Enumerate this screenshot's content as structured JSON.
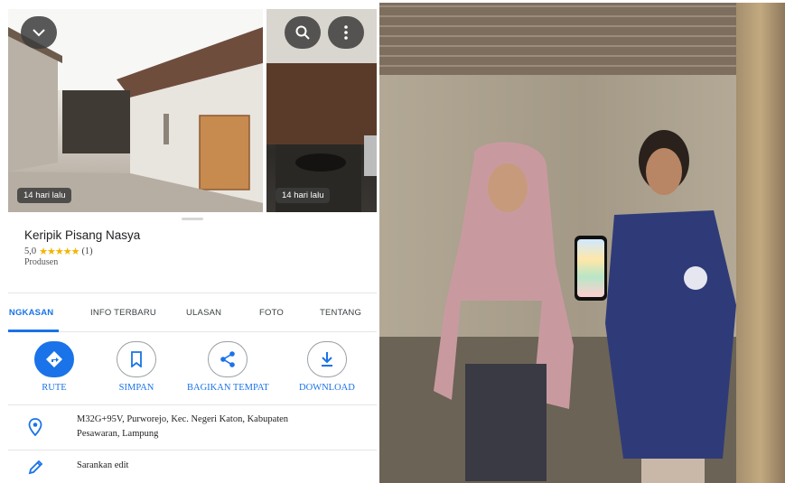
{
  "maps_screen": {
    "photos": [
      {
        "age_label": "14 hari lalu"
      },
      {
        "age_label": "14 hari lalu"
      }
    ],
    "place": {
      "name": "Keripik Pisang Nasya",
      "rating": "5,0",
      "stars": "★★★★★",
      "review_count": "(1)",
      "category": "Produsen"
    },
    "tabs": [
      {
        "label": "RINGKASAN",
        "active": true
      },
      {
        "label": "INFO TERBARU",
        "active": false
      },
      {
        "label": "ULASAN",
        "active": false
      },
      {
        "label": "FOTO",
        "active": false
      },
      {
        "label": "TENTANG",
        "active": false
      }
    ],
    "actions": [
      {
        "label": "RUTE",
        "icon": "directions-icon"
      },
      {
        "label": "SIMPAN",
        "icon": "bookmark-icon"
      },
      {
        "label": "BAGIKAN TEMPAT",
        "icon": "share-icon"
      },
      {
        "label": "DOWNLOAD",
        "icon": "download-icon"
      }
    ],
    "address_line1": "M32G+95V, Purworejo, Kec. Negeri Katon, Kabupaten",
    "address_line2": "Pesawaran, Lampung",
    "suggest_edit": "Sarankan edit"
  },
  "colors": {
    "accent": "#1a73e8",
    "star": "#f4b400"
  }
}
